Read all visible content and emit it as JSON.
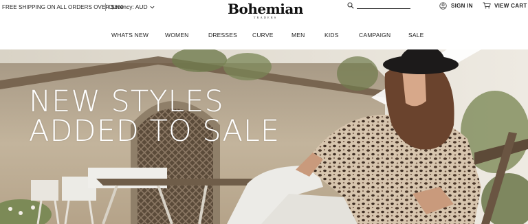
{
  "topbar": {
    "shipping_text": "FREE SHIPPING ON ALL ORDERS OVER $300",
    "currency_label": "Currency: AUD"
  },
  "logo": {
    "main": "Bohemian",
    "sub": "TRADERS"
  },
  "search": {
    "value": "",
    "placeholder": ""
  },
  "account": {
    "sign_in_label": "SIGN IN"
  },
  "cart": {
    "view_cart_label": "VIEW CART"
  },
  "nav": {
    "items": [
      {
        "label": "WHATS NEW"
      },
      {
        "label": "WOMEN"
      },
      {
        "label": "DRESSES"
      },
      {
        "label": "CURVE"
      },
      {
        "label": "MEN"
      },
      {
        "label": "KIDS"
      },
      {
        "label": "CAMPAIGN"
      },
      {
        "label": "SALE"
      }
    ]
  },
  "hero": {
    "line1": "NEW STYLES",
    "line2": "ADDED TO SALE"
  },
  "icons": {
    "search": "search-icon",
    "chevron": "chevron-down-icon",
    "user": "user-icon",
    "cart": "cart-icon"
  }
}
